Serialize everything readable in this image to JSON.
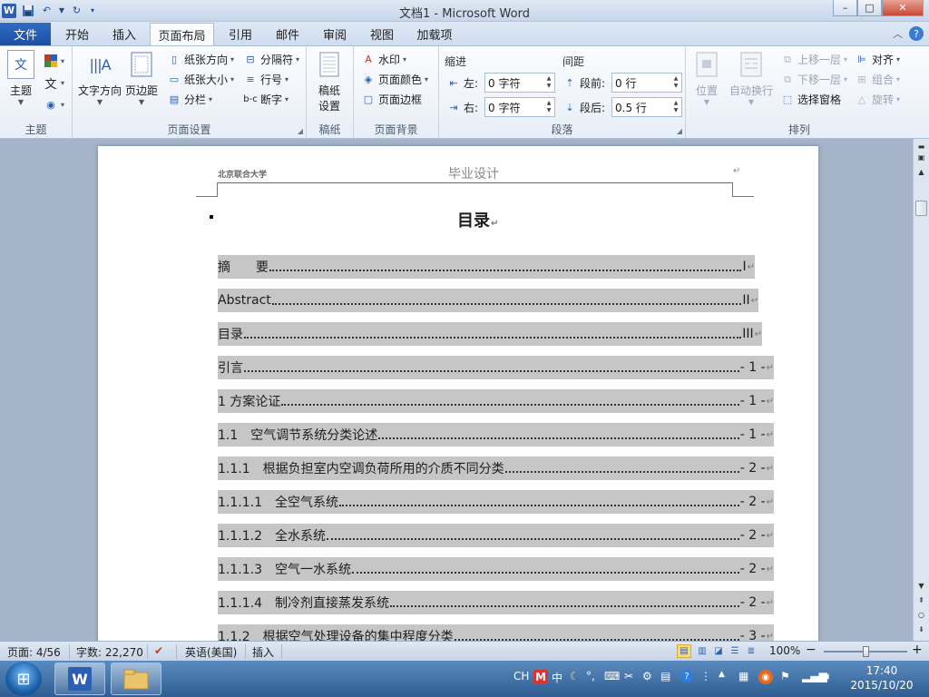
{
  "window": {
    "title": "文档1 - Microsoft Word",
    "controls": {
      "minimize": "–",
      "maximize": "□",
      "close": "✕"
    }
  },
  "quick_access": {
    "app_icon": "W"
  },
  "tabs": [
    {
      "label": "文件"
    },
    {
      "label": "开始"
    },
    {
      "label": "插入"
    },
    {
      "label": "页面布局",
      "active": true
    },
    {
      "label": "引用"
    },
    {
      "label": "邮件"
    },
    {
      "label": "审阅"
    },
    {
      "label": "视图"
    },
    {
      "label": "加载项"
    }
  ],
  "ribbon": {
    "theme": {
      "label": "主题",
      "button": "主题",
      "themes_icon": "文"
    },
    "page_setup": {
      "label": "页面设置",
      "text_direction": "文字方向",
      "margins": "页边距",
      "orientation": "纸张方向",
      "size": "纸张大小",
      "columns": "分栏",
      "breaks": "分隔符",
      "line_numbers": "行号",
      "hyphenation": "断字"
    },
    "draft_paper": {
      "label": "稿纸",
      "button_line1": "稿纸",
      "button_line2": "设置"
    },
    "page_background": {
      "label": "页面背景",
      "watermark": "水印",
      "page_color": "页面颜色",
      "page_borders": "页面边框"
    },
    "paragraph": {
      "label": "段落",
      "indent_title": "缩进",
      "spacing_title": "间距",
      "indent_left_label": "左:",
      "indent_left_value": "0 字符",
      "indent_right_label": "右:",
      "indent_right_value": "0 字符",
      "spacing_before_label": "段前:",
      "spacing_before_value": "0 行",
      "spacing_after_label": "段后:",
      "spacing_after_value": "0.5 行"
    },
    "arrange": {
      "label": "排列",
      "position": "位置",
      "wrap_text": "自动换行",
      "bring_forward": "上移一层",
      "send_backward": "下移一层",
      "selection_pane": "选择窗格",
      "align": "对齐",
      "group": "组合",
      "rotate": "旋转"
    }
  },
  "document": {
    "header_left": "北京联合大学",
    "header_center": "毕业设计",
    "header_mark": "↵",
    "toc_title": "目录",
    "paragraph_mark": "↵",
    "toc_entries": [
      {
        "text": "摘　　要",
        "page": "I"
      },
      {
        "text": "Abstract",
        "page": "II"
      },
      {
        "text": "目录",
        "page": "III"
      },
      {
        "text": "引言",
        "page": "- 1 -"
      },
      {
        "text": "1  方案论证",
        "page": "- 1 -"
      },
      {
        "text": "1.1　空气调节系统分类论述",
        "page": "- 1 -"
      },
      {
        "text": "1.1.1　根据负担室内空调负荷所用的介质不同分类",
        "page": "- 2 -"
      },
      {
        "text": "1.1.1.1　全空气系统",
        "page": "- 2 -"
      },
      {
        "text": "1.1.1.2　全水系统",
        "page": "- 2 -"
      },
      {
        "text": "1.1.1.3　空气一水系统",
        "page": "- 2 -"
      },
      {
        "text": "1.1.1.4　制冷剂直接蒸发系统",
        "page": "- 2 -"
      },
      {
        "text": "1.1.2　根据空气处理设备的集中程度分类",
        "page": "- 3 -"
      }
    ]
  },
  "statusbar": {
    "page": "页面: 4/56",
    "words": "字数: 22,270",
    "language": "英语(美国)",
    "mode": "插入",
    "zoom": "100%",
    "zoom_minus": "−",
    "zoom_plus": "+"
  },
  "taskbar": {
    "ime": "CH",
    "ime_zh": "中",
    "clock_time": "17:40",
    "clock_date": "2015/10/20"
  },
  "colors": {
    "accent": "#2b5fb4",
    "file_tab": "#1b4fa3",
    "toc_highlight": "#c6c6c6",
    "doc_background": "#a5b4c8"
  }
}
